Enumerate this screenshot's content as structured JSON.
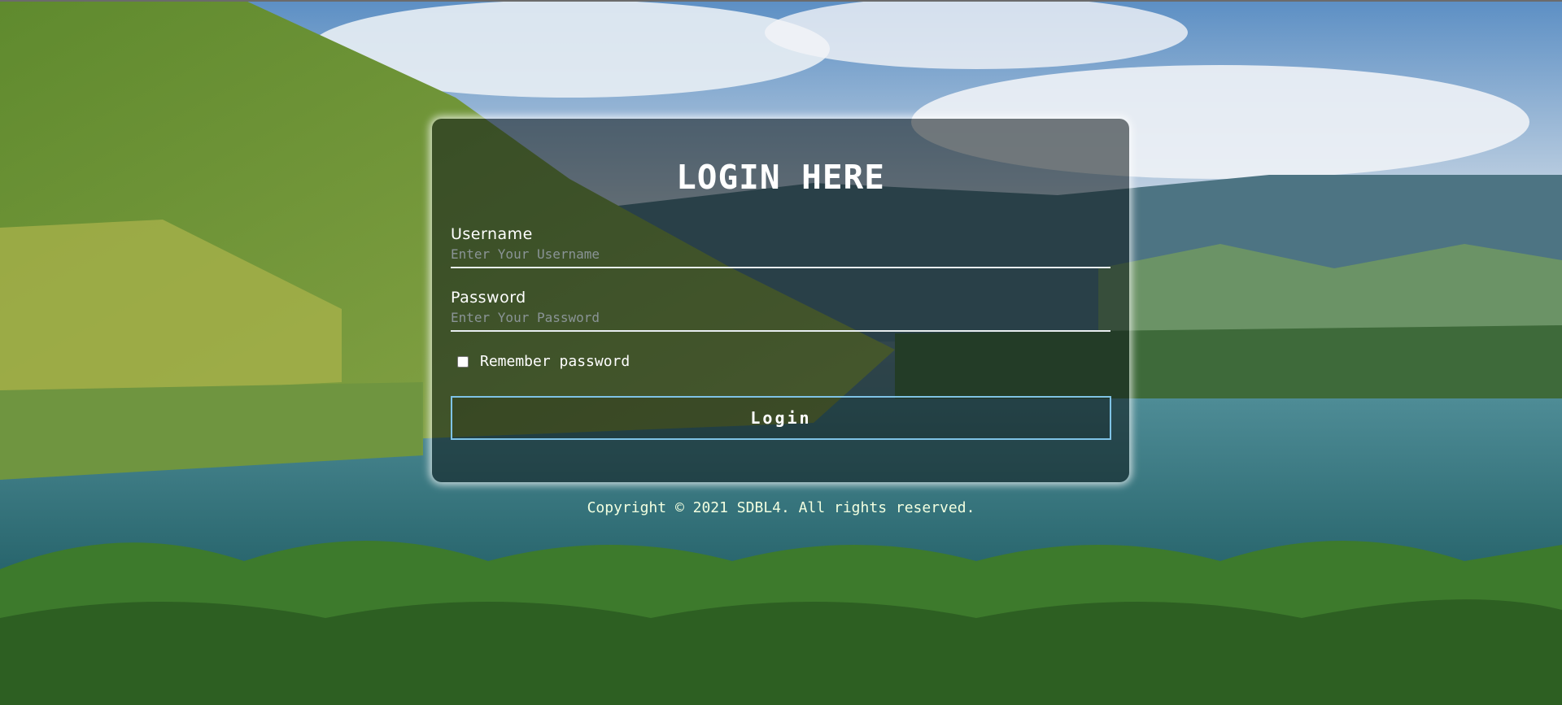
{
  "page": {
    "title": "LOGIN HERE",
    "copyright": "Copyright © 2021 SDBL4. All rights reserved."
  },
  "form": {
    "username_label": "Username",
    "username_placeholder": "Enter Your Username",
    "username_value": "",
    "password_label": "Password",
    "password_placeholder": "Enter Your Password",
    "password_value": "",
    "remember_label": "Remember password",
    "remember_checked": false,
    "submit_label": "Login"
  },
  "colors": {
    "button_border": "#7fc3e6",
    "card_bg": "rgba(12,22,24,0.55)",
    "text": "#ffffff"
  },
  "background": {
    "description_icon": "landscape-image"
  }
}
